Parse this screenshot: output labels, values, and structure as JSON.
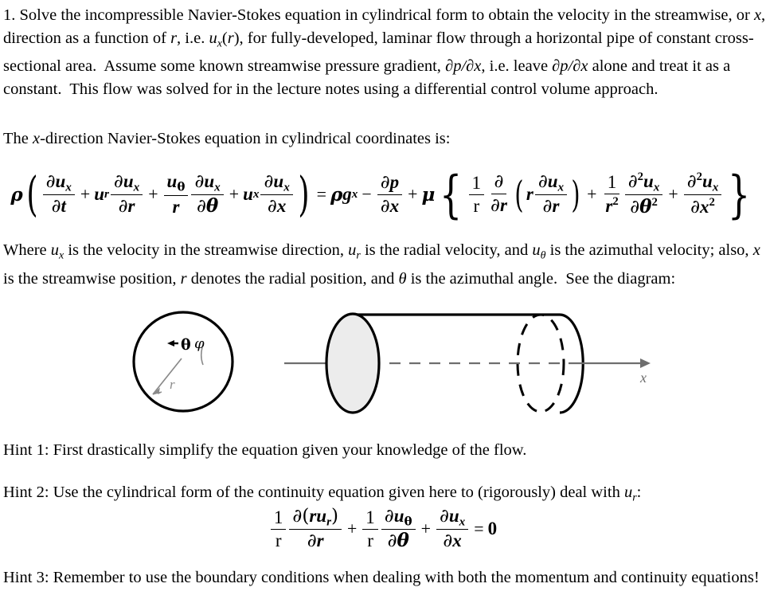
{
  "document": {
    "problem_number": "1.",
    "intro_text": "1. Solve the incompressible Navier-Stokes equation in cylindrical form to obtain the velocity in the streamwise, or x, direction as a function of r, i.e. ux(r), for fully-developed, laminar flow through a horizontal pipe of constant cross-sectional area.  Assume some known streamwise pressure gradient, ∂p/∂x, i.e. leave ∂p/∂x alone and treat it as a constant.  This flow was solved for in the lecture notes using a differential control volume approach.",
    "intro_parts": {
      "a": "1. Solve the incompressible Navier-Stokes equation in cylindrical form to obtain the velocity in the streamwise, or ",
      "var_x": "x",
      "b": ", direction as a function of ",
      "var_r": "r",
      "c": ", i.e. ",
      "var_u": "u",
      "var_u_sub": "x",
      "d": "(",
      "var_r2": "r",
      "e": "), for fully-developed, laminar flow through a horizontal pipe of constant cross-sectional area.  Assume some known streamwise pressure gradient, ",
      "grad1": "∂p/∂x",
      "f": ", i.e. leave ",
      "grad2": "∂p/∂x",
      "g": " alone and treat it as a constant.  This flow was solved for in the lecture notes using a differential control volume approach."
    },
    "xdir_line": {
      "a": "The ",
      "var_x": "x",
      "b": "-direction Navier-Stokes equation in cylindrical coordinates is:"
    },
    "where_paragraph": {
      "a": "Where ",
      "u1": "u",
      "u1sub": "x",
      "b": " is the velocity in the streamwise direction, ",
      "u2": "u",
      "u2sub": "r",
      "c": " is the radial velocity, and ",
      "u3": "u",
      "u3sub": "θ",
      "d": " is the azimuthal velocity; also, ",
      "var_x": "x",
      "e": " is the streamwise position, ",
      "var_r": "r",
      "f": " denotes the radial position, and ",
      "var_theta": "θ",
      "g": " is the azimuthal angle.  See the diagram:"
    },
    "hint1": "Hint 1: First drastically simplify the equation given your knowledge of the flow.",
    "hint2": {
      "a": "Hint 2: Use the cylindrical form of the continuity equation given here to (rigorously) deal with ",
      "u": "u",
      "usub": "r",
      "b": ":"
    },
    "hint3": "Hint 3: Remember to use the boundary conditions when dealing with both the momentum and continuity equations!"
  },
  "equations": {
    "momentum": {
      "description": "x-direction Navier-Stokes equation in cylindrical coordinates",
      "rho": "ρ",
      "partial": "∂",
      "u": "u",
      "t": "t",
      "r": "r",
      "theta": "θ",
      "x": "x",
      "g": "g",
      "p": "p",
      "mu": "μ",
      "one": "1",
      "two": "2",
      "plus": "+",
      "minus": "−",
      "equals": "=",
      "lparen": "(",
      "rparen": ")",
      "lbrace": "{",
      "rbrace": "}"
    },
    "continuity": {
      "description": "cylindrical form of the continuity equation",
      "partial": "∂",
      "u": "u",
      "r": "r",
      "theta": "θ",
      "x": "x",
      "one": "1",
      "zero": "0",
      "plus": "+",
      "equals": "=",
      "lparen": "(",
      "rparen": ")"
    }
  },
  "diagram": {
    "circle": {
      "label_theta": "θ",
      "label_phi": "φ",
      "label_r": "r"
    },
    "cylinder": {
      "label_x": "x",
      "fill_color": "#ececec",
      "outline_color": "#000000",
      "axis_color": "#666666"
    }
  },
  "colors": {
    "text": "#000000",
    "background": "#ffffff",
    "diagram_gray": "#777777",
    "cylinder_fill": "#ececec"
  }
}
